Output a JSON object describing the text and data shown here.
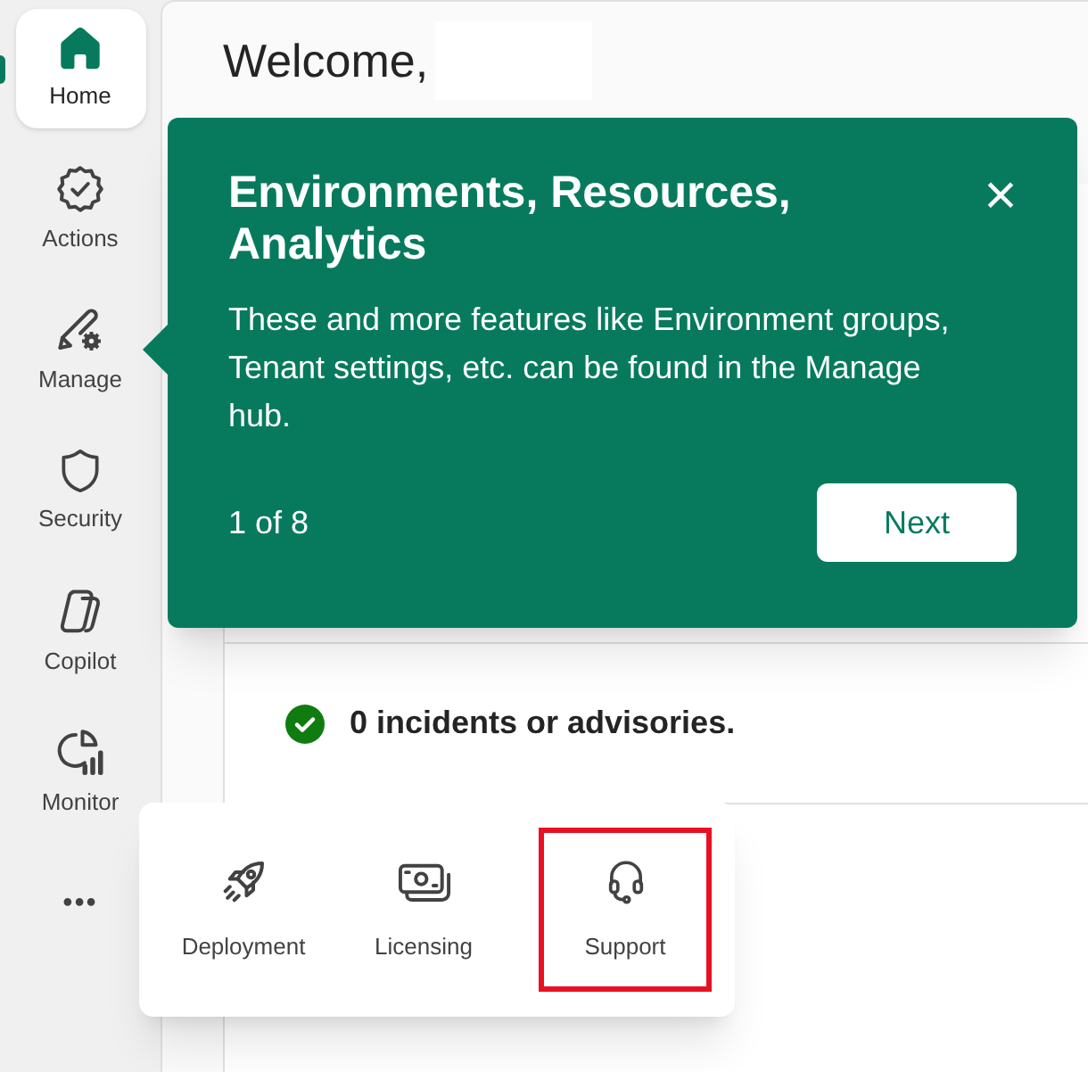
{
  "sidebar": {
    "items": [
      {
        "label": "Home",
        "selected": true
      },
      {
        "label": "Actions",
        "selected": false
      },
      {
        "label": "Manage",
        "selected": false
      },
      {
        "label": "Security",
        "selected": false
      },
      {
        "label": "Copilot",
        "selected": false
      },
      {
        "label": "Monitor",
        "selected": false
      }
    ],
    "more": "•••"
  },
  "header": {
    "greeting": "Welcome,"
  },
  "service_health": {
    "status": "0 incidents or advisories.",
    "ok": true
  },
  "teaching_popover": {
    "title": "Environments, Resources, Analytics",
    "body": "These and more features like Environment groups, Tenant settings, etc. can be found in the Manage hub.",
    "step": "1 of 8",
    "next_button": "Next",
    "close": "×"
  },
  "more_flyout": {
    "items": [
      {
        "label": "Deployment",
        "highlighted": false
      },
      {
        "label": "Licensing",
        "highlighted": false
      },
      {
        "label": "Support",
        "highlighted": true
      }
    ]
  }
}
